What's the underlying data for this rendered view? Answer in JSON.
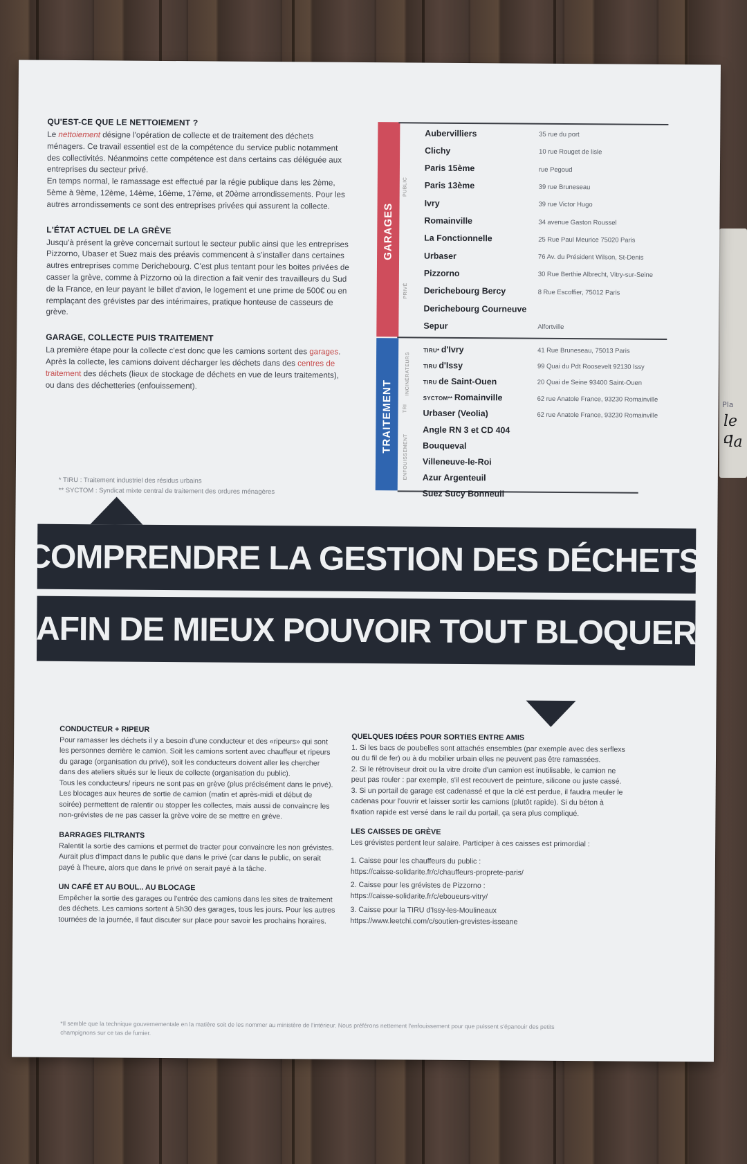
{
  "poster": {
    "q1": {
      "title": "QU'EST-CE QUE LE NETTOIEMENT ?",
      "p1_word": "nettoiement",
      "p1_prefix": "Le ",
      "p1_rest": " désigne l'opération de collecte et de traitement des déchets ménagers. Ce travail essentiel est de la compétence du service public notamment des collectivités. Néanmoins cette compétence est dans certains cas déléguée aux entreprises du secteur privé.",
      "p2": "En temps normal, le ramassage est effectué par la régie publique dans les 2ème, 5ème à 9ème, 12ème, 14ème, 16ème, 17ème, et 20ème arrondissements. Pour les autres arrondissements ce sont des entreprises privées qui assurent la collecte."
    },
    "q2": {
      "title": "L'ÉTAT ACTUEL DE LA GRÈVE",
      "text": "Jusqu'à présent la grève concernait surtout le secteur public ainsi que les entreprises Pizzorno, Ubaser et Suez mais des préavis commencent à s'installer dans certaines autres entreprises comme Derichebourg. C'est plus tentant pour les boites privées de casser la grève, comme à Pizzorno où la direction a fait venir des travailleurs du Sud de la France, en leur payant le billet d'avion, le logement et une prime de 500€ ou en remplaçant des grévistes par des intérimaires, pratique honteuse de casseurs de grève."
    },
    "q3": {
      "title": "GARAGE, COLLECTE PUIS TRAITEMENT",
      "t1": "La première étape pour la collecte c'est donc que les camions sortent des ",
      "w1": "garages",
      "t2": ". Après la collecte, les camions doivent décharger les déchets dans des ",
      "w2": "centres de traitement",
      "t3": " des déchets (lieux de stockage de déchets en vue de leurs traitements), ou dans des déchetteries (enfouissement)."
    },
    "notes": {
      "n1": "* TIRU : Traitement industriel des résidus urbains",
      "n2": "** SYCTOM : Syndicat mixte central de traitement des ordures ménagères"
    },
    "facilities": {
      "garages_label": "GARAGES",
      "traitement_label": "TRAITEMENT",
      "public_label": "PUBLIC",
      "prive_label": "PRIVÉ",
      "incin_label": "INCINÉRATEURS",
      "tri_label": "TRI",
      "enfouis_label": "ENFOUISSEMENT",
      "rows": [
        {
          "name": "Aubervilliers",
          "addr": "35 rue du port"
        },
        {
          "name": "Clichy",
          "addr": "10 rue Rouget de lisle"
        },
        {
          "name": "Paris 15ème",
          "addr": "rue Pegoud"
        },
        {
          "name": "Paris 13ème",
          "addr": "39 rue Bruneseau"
        },
        {
          "name": "Ivry",
          "addr": "39 rue Victor Hugo"
        },
        {
          "name": "Romainville",
          "addr": "34 avenue Gaston Roussel"
        },
        {
          "name": "La Fonctionnelle",
          "addr": "25 Rue Paul Meurice 75020 Paris"
        },
        {
          "name": "Urbaser",
          "addr": "76 Av. du Président Wilson, St-Denis"
        },
        {
          "name": "Pizzorno",
          "addr": "30 Rue Berthie Albrecht, Vitry-sur-Seine"
        },
        {
          "name": "Derichebourg Bercy",
          "addr": "8 Rue Escoffier, 75012 Paris"
        },
        {
          "name": "Derichebourg Courneuve",
          "addr": ""
        },
        {
          "name": "Sepur",
          "addr": "Alfortville"
        },
        {
          "prefix": "TIRU* ",
          "name": "d'Ivry",
          "addr": "41 Rue Bruneseau, 75013 Paris"
        },
        {
          "prefix": "TIRU ",
          "name": "d'Issy",
          "addr": "99 Quai du Pdt Roosevelt 92130 Issy"
        },
        {
          "prefix": "TIRU ",
          "name": "de Saint-Ouen",
          "addr": "20 Quai de Seine 93400 Saint-Ouen"
        },
        {
          "prefix": "SYCTOM** ",
          "name": "Romainville",
          "addr": "62 rue Anatole France, 93230 Romainville"
        },
        {
          "name": "Urbaser (Veolia)",
          "addr": "62 rue Anatole France, 93230 Romainville"
        },
        {
          "name": "Angle RN 3 et CD 404",
          "addr": ""
        },
        {
          "name": "Bouqueval",
          "addr": ""
        },
        {
          "name": "Villeneuve-le-Roi",
          "addr": ""
        },
        {
          "name": "Azur Argenteuil",
          "addr": ""
        },
        {
          "name": "Suez Sucy Bonneuil",
          "addr": ""
        }
      ]
    },
    "banner": {
      "line1": "COMPRENDRE LA GESTION DES DÉCHETS",
      "star": "*",
      "line2": "AFIN DE MIEUX POUVOIR TOUT BLOQUER"
    },
    "left": {
      "b1_title": "CONDUCTEUR + RIPEUR",
      "b1_text": "Pour ramasser les déchets il y a besoin d'une conducteur et des «ripeurs» qui sont les personnes derrière le camion. Soit les camions sortent avec chauffeur et ripeurs du garage (organisation du privé), soit les conducteurs doivent aller les chercher dans des ateliers situés sur le lieux de collecte (organisation du public).",
      "b1_text2": "Tous les conducteurs/ ripeurs ne sont pas en grève (plus précisément dans le privé). Les blocages aux heures de sortie de camion (matin et après-midi et début de soirée) permettent de ralentir ou stopper les collectes, mais aussi de convaincre les non-grévistes de ne pas casser la grève voire de se mettre en grève.",
      "b2_title": "BARRAGES FILTRANTS",
      "b2_text": "Ralentit la sortie des camions et permet de tracter pour convaincre les non grévistes. Aurait plus d'impact dans le public que dans le privé (car dans le public, on serait payé à l'heure, alors que dans le privé on serait payé à la tâche.",
      "b3_title": "UN CAFÉ ET AU BOUL.. AU BLOCAGE",
      "b3_text": "Empêcher la sortie des garages ou l'entrée des camions dans les sites de traitement des déchets. Les camions sortent à 5h30 des garages, tous les jours. Pour les autres tournées de la journée, il faut discuter sur place pour savoir les prochains horaires."
    },
    "right": {
      "b1_title": "QUELQUES IDÉES POUR SORTIES ENTRE AMIS",
      "i1": "1. Si les bacs de poubelles sont attachés ensembles (par exemple avec des serflexs ou du fil de fer) ou à du mobilier urbain elles ne peuvent pas être ramassées.",
      "i2": "2. Si le rétroviseur droit ou la vitre droite d'un camion est inutilisable, le camion ne peut pas rouler : par exemple, s'il est recouvert de peinture, silicone ou juste cassé.",
      "i3": "3. Si un portail de garage est cadenassé et que la clé est perdue, il faudra meuler le cadenas pour l'ouvrir et laisser sortir les camions (plutôt rapide). Si du béton à fixation rapide est versé dans le rail du portail, ça sera plus compliqué.",
      "b2_title": "LES CAISSES DE GRÈVE",
      "b2_text": "Les grévistes perdent leur salaire. Participer à ces caisses est primordial :",
      "c1": "1. Caisse pour les chauffeurs du public :",
      "c1u": "https://caisse-solidarite.fr/c/chauffeurs-proprete-paris/",
      "c2": "2. Caisse pour les grévistes de Pizzorno :",
      "c2u": "https://caisse-solidarite.fr/c/eboueurs-vitry/",
      "c3": "3. Caisse pour la TIRU d'Issy-les-Moulineaux",
      "c3u": "https://www.leetchi.com/c/soutien-grevistes-isseane"
    },
    "footnote": "*Il semble que la technique gouvernementale en la matière soit de les nommer au ministère de l'intérieur. Nous préférons nettement l'enfouissement pour que puissent s'épanouir des petits champignons sur ce tas de fumier."
  },
  "side_fragment": {
    "f1": "Pla",
    "f2": "le c",
    "f3": "-la"
  },
  "colors": {
    "garages_bar": "#cf4d5c",
    "traitement_bar": "#2f65b0",
    "banner": "#242933",
    "paper": "#eef0f2"
  }
}
